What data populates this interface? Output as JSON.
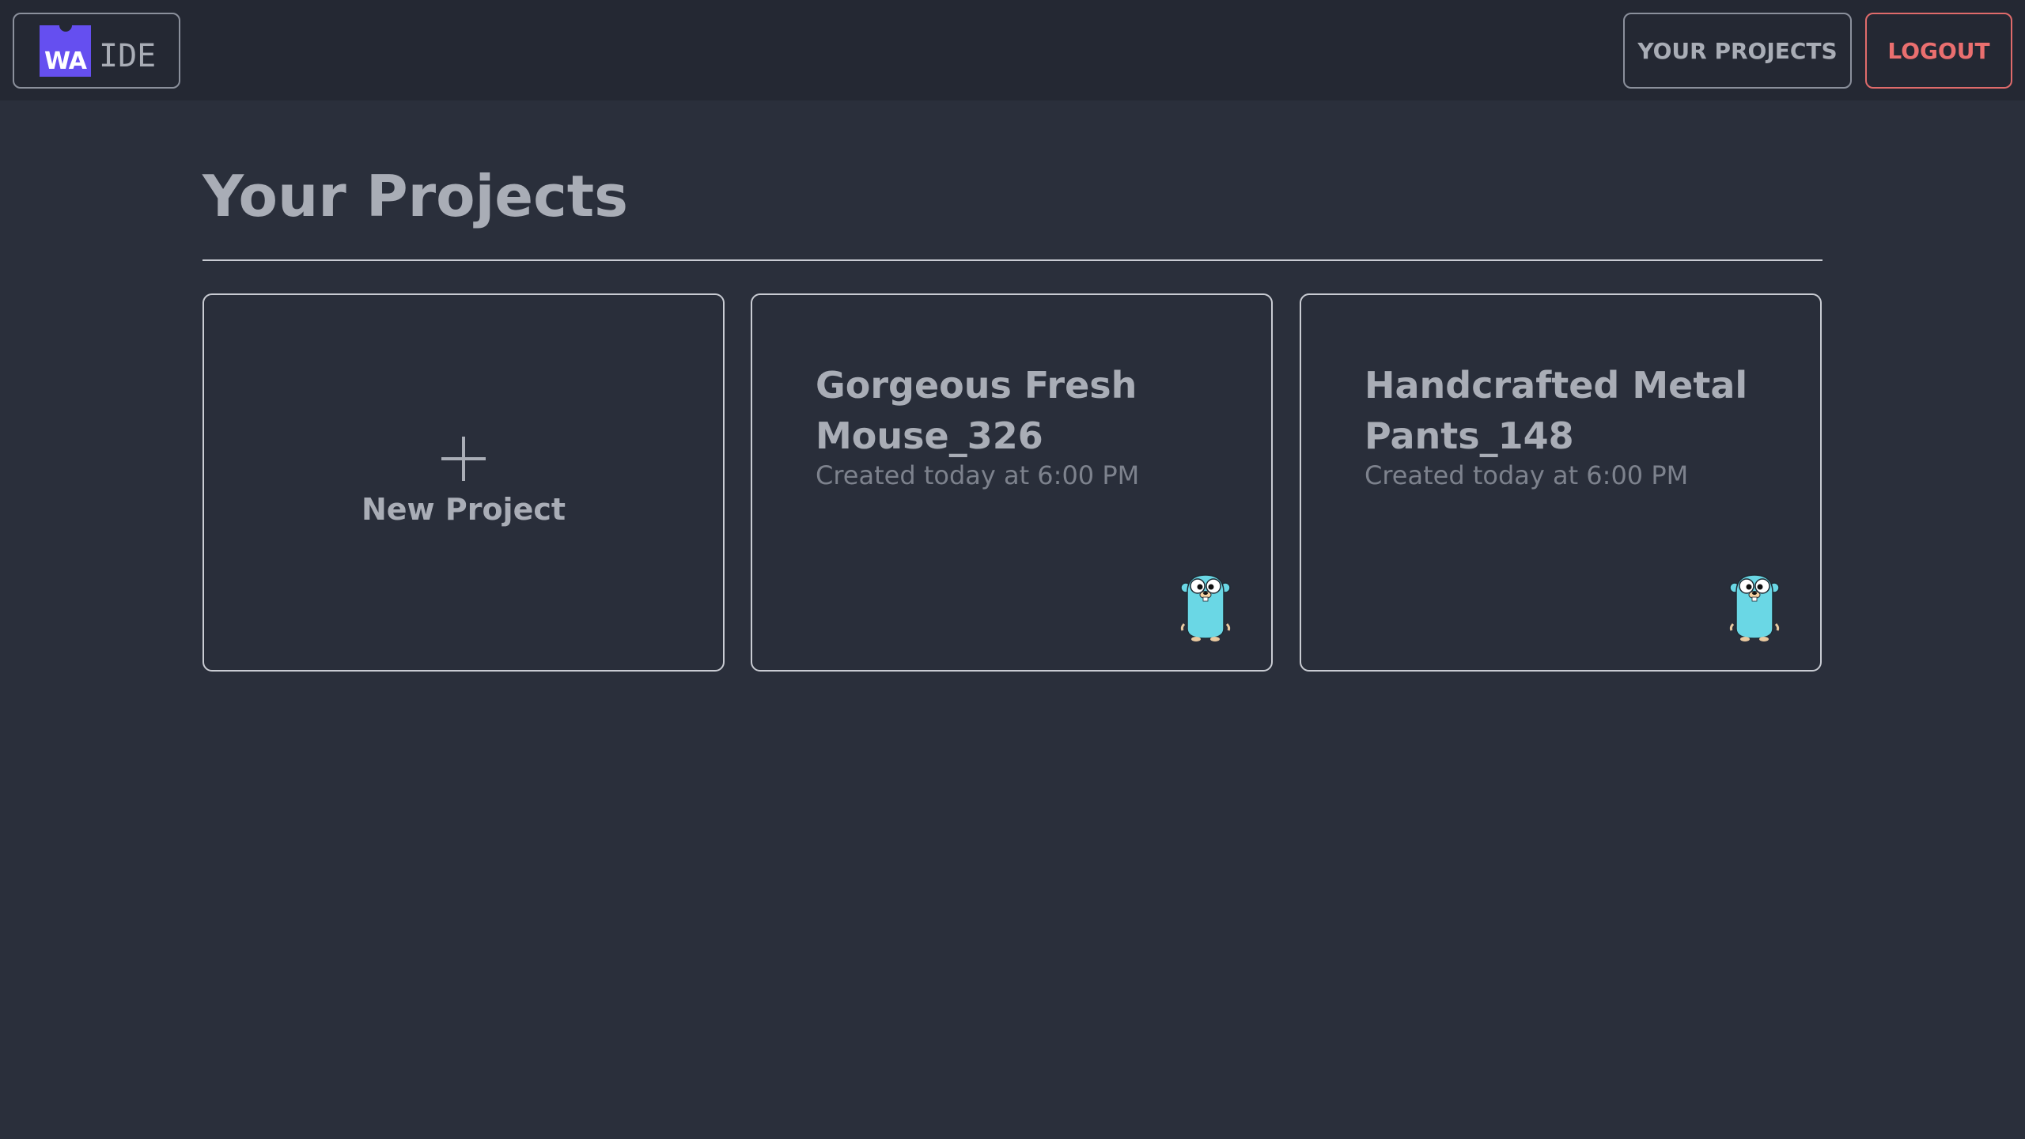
{
  "header": {
    "logo_mark": "WA",
    "logo_text": "IDE",
    "nav": {
      "projects_label": "YOUR PROJECTS",
      "logout_label": "LOGOUT"
    }
  },
  "main": {
    "title": "Your Projects",
    "new_project": {
      "label": "New Project",
      "icon": "plus-icon"
    },
    "projects": [
      {
        "name": "Gorgeous Fresh Mouse_326",
        "created": "Created today at 6:00 PM",
        "icon": "gopher-icon"
      },
      {
        "name": "Handcrafted Metal Pants_148",
        "created": "Created today at 6:00 PM",
        "icon": "gopher-icon"
      }
    ]
  },
  "colors": {
    "background": "#2a2f3b",
    "header_background": "#242833",
    "logo_accent": "#654ff0",
    "text": "#a9adb6",
    "muted_text": "#7d828d",
    "logout_accent": "#ea6f6f",
    "gopher": "#6ad7e5"
  }
}
